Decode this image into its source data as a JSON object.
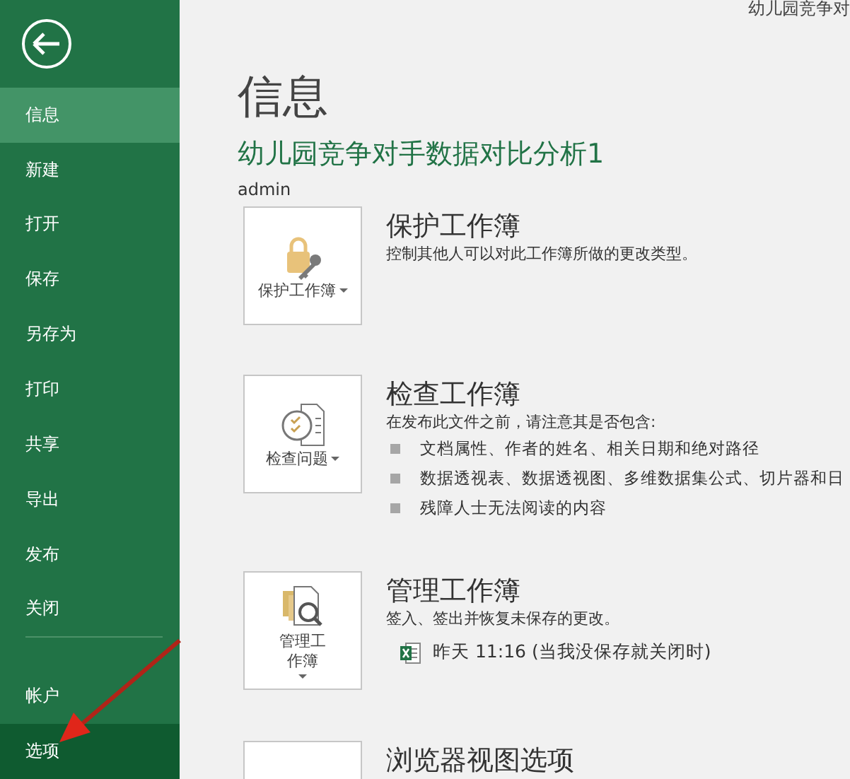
{
  "window": {
    "title": "幼儿园竞争对"
  },
  "sidebar": {
    "items": [
      {
        "label": "信息",
        "selected": true,
        "hovered": false
      },
      {
        "label": "新建",
        "selected": false,
        "hovered": false
      },
      {
        "label": "打开",
        "selected": false,
        "hovered": false
      },
      {
        "label": "保存",
        "selected": false,
        "hovered": false
      },
      {
        "label": "另存为",
        "selected": false,
        "hovered": false
      },
      {
        "label": "打印",
        "selected": false,
        "hovered": false
      },
      {
        "label": "共享",
        "selected": false,
        "hovered": false
      },
      {
        "label": "导出",
        "selected": false,
        "hovered": false
      },
      {
        "label": "发布",
        "selected": false,
        "hovered": false
      },
      {
        "label": "关闭",
        "selected": false,
        "hovered": false
      }
    ],
    "footer_items": [
      {
        "label": "帐户",
        "selected": false,
        "hovered": false
      },
      {
        "label": "选项",
        "selected": false,
        "hovered": true
      }
    ]
  },
  "page_title": "信息",
  "document_title": "幼儿园竞争对手数据对比分析1",
  "author": "admin",
  "sections": [
    {
      "kind": "protect",
      "button_label": "保护工作簿",
      "heading": "保护工作簿",
      "description": "控制其他人可以对此工作簿所做的更改类型。"
    },
    {
      "kind": "inspect",
      "button_label": "检查问题",
      "heading": "检查工作簿",
      "description": "在发布此文件之前，请注意其是否包含:",
      "bullets": [
        "文档属性、作者的姓名、相关日期和绝对路径",
        "数据透视表、数据透视图、多维数据集公式、切片器和日",
        "残障人士无法阅读的内容"
      ]
    },
    {
      "kind": "manage",
      "button_label": "管理工作簿",
      "heading": "管理工作簿",
      "description": "签入、签出并恢复未保存的更改。",
      "versions": [
        "昨天 11:16 (当我没保存就关闭时)"
      ]
    },
    {
      "kind": "browser",
      "heading": "浏览器视图选项"
    }
  ]
}
